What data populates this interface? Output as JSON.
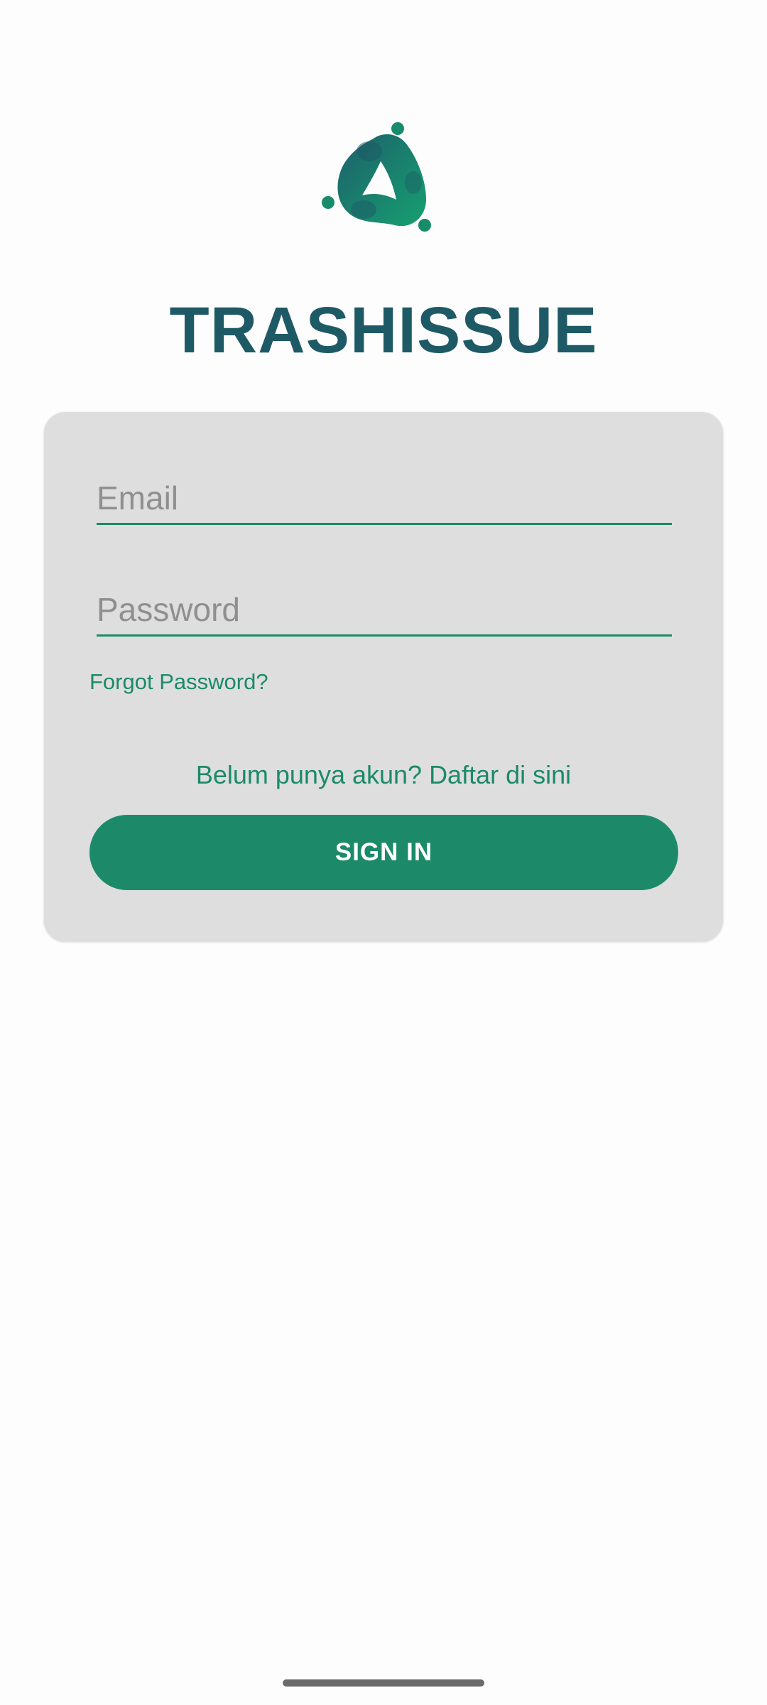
{
  "app": {
    "title": "TRASHISSUE",
    "logo_icon": "recycle-figures-logo"
  },
  "login_form": {
    "email_placeholder": "Email",
    "email_value": "",
    "password_placeholder": "Password",
    "password_value": "",
    "forgot_password_label": "Forgot Password?",
    "register_label": "Belum punya akun? Daftar di sini",
    "sign_in_label": "SIGN IN"
  },
  "colors": {
    "brand_green": "#1c8a68",
    "title_teal": "#1e5a66",
    "card_background": "#dedede",
    "page_background": "#fdfdfd"
  }
}
